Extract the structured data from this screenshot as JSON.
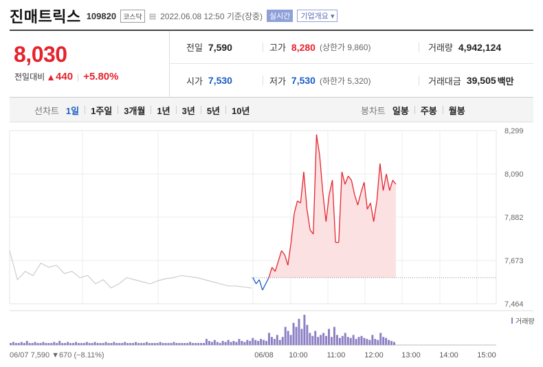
{
  "header": {
    "title": "진매트릭스",
    "code": "109820",
    "market": "코스닥",
    "datetime": "2022.06.08 12:50 기준(장중)",
    "realtime_label": "실시간",
    "company_label": "기업개요 ▾"
  },
  "price": {
    "current": "8,030",
    "change_label": "전일대비",
    "change_value": "440",
    "change_pct": "+5.80%"
  },
  "summary": {
    "prev": {
      "label": "전일",
      "value": "7,590"
    },
    "high": {
      "label": "고가",
      "value": "8,280",
      "sub": "(상한가 9,860)"
    },
    "volume": {
      "label": "거래량",
      "value": "4,942,124"
    },
    "open": {
      "label": "시가",
      "value": "7,530"
    },
    "low": {
      "label": "저가",
      "value": "7,530",
      "sub": "(하한가 5,320)"
    },
    "amount": {
      "label": "거래대금",
      "value": "39,505",
      "unit": "백만"
    }
  },
  "tabs": {
    "line_label": "선차트",
    "line": [
      "1일",
      "1주일",
      "3개월",
      "1년",
      "3년",
      "5년",
      "10년"
    ],
    "candle_label": "봉차트",
    "candle": [
      "일봉",
      "주봉",
      "월봉"
    ]
  },
  "colors": {
    "up": "#e5232d",
    "down": "#1a5bc4",
    "area": "#fbe1e2",
    "prev_day": "#cccccc",
    "volume": "#8c7fc4"
  },
  "chart_data": {
    "type": "line",
    "y_ticks": [
      "8,299",
      "8,090",
      "7,882",
      "7,673",
      "7,464"
    ],
    "ylim": [
      7464,
      8299
    ],
    "x_labels": [
      "06/08",
      "10:00",
      "11:00",
      "12:00",
      "13:00",
      "14:00",
      "15:00"
    ],
    "prev_close": 7590,
    "volume_label": "거래량",
    "prev_day_summary": "06/07 7,590 ▼670 (−8.11%)",
    "series": [
      {
        "values": [
          7720,
          7580,
          7620,
          7600,
          7660,
          7640,
          7650,
          7610,
          7620,
          7590,
          7600,
          7560,
          7580,
          7540,
          7560,
          7590,
          7580,
          7570,
          7560,
          7575,
          7585,
          7590,
          7600,
          7595,
          7590,
          7580,
          7570,
          7560,
          7550,
          7550,
          7545,
          7540
        ]
      },
      {
        "values": [
          7590,
          7560,
          7580,
          7530,
          7560,
          7590,
          7640,
          7620,
          7670,
          7720,
          7700,
          7650,
          7760,
          7900,
          7960,
          7950,
          8100,
          7920,
          7820,
          7800,
          8280,
          8180,
          8000,
          7860,
          7990,
          8060,
          7760,
          7760,
          8100,
          8040,
          8080,
          8060,
          7990,
          7940,
          8000,
          8050,
          7920,
          7950,
          7860,
          7960,
          8140,
          8010,
          8090,
          8010,
          8060,
          8040
        ]
      }
    ],
    "volume": [
      2,
      3,
      2,
      2,
      3,
      2,
      4,
      2,
      2,
      3,
      2,
      2,
      3,
      2,
      2,
      2,
      3,
      2,
      4,
      2,
      2,
      3,
      2,
      2,
      3,
      2,
      2,
      2,
      3,
      2,
      2,
      3,
      2,
      2,
      2,
      3,
      2,
      2,
      3,
      2,
      2,
      2,
      3,
      2,
      2,
      2,
      3,
      2,
      2,
      2,
      3,
      2,
      2,
      2,
      2,
      3,
      2,
      2,
      2,
      2,
      3,
      2,
      2,
      2,
      2,
      2,
      3,
      2,
      2,
      2,
      2,
      2,
      6,
      4,
      3,
      5,
      3,
      2,
      4,
      3,
      5,
      3,
      4,
      3,
      6,
      4,
      3,
      5,
      4,
      7,
      5,
      4,
      6,
      5,
      4,
      12,
      8,
      6,
      10,
      5,
      8,
      18,
      14,
      10,
      22,
      18,
      26,
      16,
      30,
      20,
      12,
      9,
      14,
      8,
      10,
      12,
      9,
      16,
      8,
      18,
      10,
      7,
      9,
      12,
      8,
      7,
      10,
      6,
      8,
      9,
      7,
      6,
      5,
      10,
      6,
      5,
      12,
      8,
      7,
      5,
      4,
      3
    ]
  }
}
